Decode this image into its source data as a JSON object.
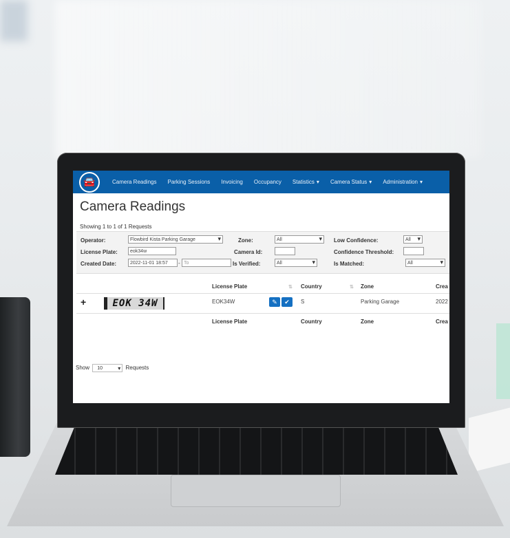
{
  "nav": {
    "items": [
      "Camera Readings",
      "Parking Sessions",
      "Invoicing",
      "Occupancy",
      "Statistics",
      "Camera Status",
      "Administration"
    ],
    "dropdown_flags": [
      false,
      false,
      false,
      false,
      true,
      true,
      true
    ]
  },
  "page": {
    "title": "Camera Readings",
    "showing": "Showing 1 to 1 of 1 Requests"
  },
  "filters": {
    "operator_label": "Operator:",
    "operator_value": "Flowbird Kista Parking Garage",
    "plate_label": "License Plate:",
    "plate_value": "eok34w",
    "created_label": "Created Date:",
    "created_from": "2022-11-01 18:57",
    "created_sep": "-",
    "created_to_placeholder": "To",
    "zone_label": "Zone:",
    "zone_value": "All",
    "camera_label": "Camera Id:",
    "camera_value": "",
    "verified_label": "Is Verified:",
    "verified_value": "All",
    "lowconf_label": "Low Confidence:",
    "lowconf_value": "All",
    "threshold_label": "Confidence Threshold:",
    "threshold_value": "",
    "matched_label": "Is Matched:",
    "matched_value": "All"
  },
  "table": {
    "headers": {
      "plate": "License Plate",
      "country": "Country",
      "zone": "Zone",
      "created": "Crea"
    },
    "row": {
      "plate_image_text": "EOK 34W",
      "plate": "EOK34W",
      "country": "S",
      "zone": "Parking Garage",
      "created": "2022"
    },
    "expand": "+",
    "icons": {
      "edit": "pencil-icon",
      "verify": "check-icon"
    }
  },
  "pager": {
    "show": "Show",
    "page_size": "10",
    "requests": "Requests"
  },
  "colors": {
    "nav": "#0a5fa8",
    "button": "#1570c2"
  }
}
